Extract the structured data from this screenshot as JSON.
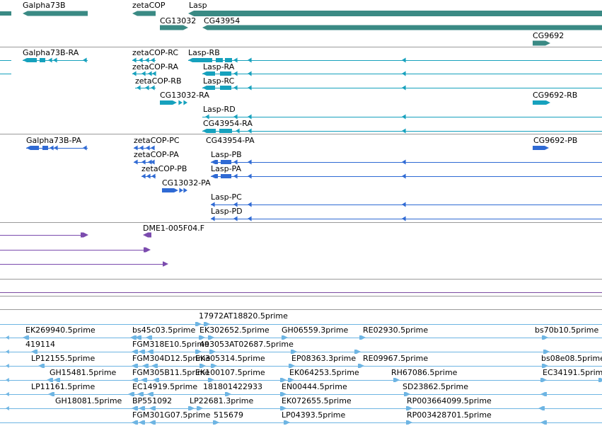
{
  "colors": {
    "gene": "#3a8a84",
    "transcript": "#16a1bd",
    "protein": "#2f6ad4",
    "clone": "#7b4bae",
    "est": "#6eb5e3",
    "divider": "#9a9a9a",
    "purple_divider": "#7a4aa0"
  },
  "gene_track": {
    "labels": [
      "Galpha73B",
      "zetaCOP",
      "Lasp",
      "CG13032",
      "CG43954",
      "CG9692"
    ]
  },
  "transcript_track": {
    "labels": [
      "Galpha73B-RA",
      "zetaCOP-RC",
      "Lasp-RB",
      "zetaCOP-RA",
      "Lasp-RA",
      "zetaCOP-RB",
      "Lasp-RC",
      "CG13032-RA",
      "CG9692-RB",
      "Lasp-RD",
      "CG43954-RA"
    ]
  },
  "protein_track": {
    "labels": [
      "Galpha73B-PA",
      "zetaCOP-PC",
      "CG43954-PA",
      "CG9692-PB",
      "zetaCOP-PA",
      "Lasp-PB",
      "zetaCOP-PB",
      "Lasp-PA",
      "CG13032-PA",
      "Lasp-PC",
      "Lasp-PD"
    ]
  },
  "clone_track": {
    "labels": [
      "DME1-005F04.F"
    ]
  },
  "est_track": {
    "labels": [
      "17972AT18820.5prime",
      "EK269940.5prime",
      "bs45c03.5prime",
      "EK302652.5prime",
      "GH06559.3prime",
      "RE02930.5prime",
      "bs70b10.5prime",
      "419114",
      "FGM318E10.5prime",
      "493053AT02687.5prime",
      "LP12155.5prime",
      "FGM304D12.5prime",
      "EK305314.5prime",
      "EP08363.3prime",
      "RE09967.5prime",
      "bs08e08.5prime",
      "GH15481.5prime",
      "FGM305B11.5prime",
      "EK100107.5prime",
      "EK064253.5prime",
      "RH67086.5prime",
      "EC34191.5prime",
      "LP11161.5prime",
      "EC14919.5prime",
      "181801422933",
      "EN00444.5prime",
      "SD23862.5prime",
      "GH18081.5prime",
      "BP551092",
      "LP22681.3prime",
      "EK072655.5prime",
      "RP003664099.5prime",
      "FGM301G07.5prime",
      "515679",
      "LP04393.5prime",
      "RP003428701.5prime"
    ]
  }
}
